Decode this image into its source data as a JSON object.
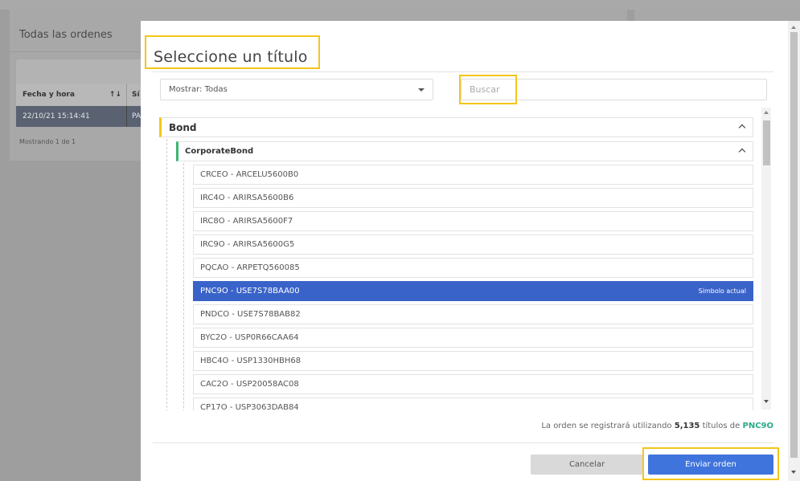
{
  "background": {
    "panel_title": "Todas las ordenes",
    "table": {
      "col1": "Fecha y hora",
      "col2": "Sí",
      "row_datetime": "22/10/21 15:14:41",
      "row_col2": "PA",
      "sort_glyph": "↑↓"
    },
    "footer": "Mostrando 1 de 1"
  },
  "modal": {
    "title": "Seleccione un título",
    "filter": {
      "selected": "Mostrar: Todas"
    },
    "search": {
      "placeholder": "Buscar",
      "value": ""
    },
    "tree": {
      "level1": "Bond",
      "level2": "CorporateBond",
      "items": [
        {
          "label": "CRCEO - ARCELU5600B0",
          "note": ""
        },
        {
          "label": "IRC4O - ARIRSA5600B6",
          "note": ""
        },
        {
          "label": "IRC8O - ARIRSA5600F7",
          "note": ""
        },
        {
          "label": "IRC9O - ARIRSA5600G5",
          "note": ""
        },
        {
          "label": "PQCAO - ARPETQ560085",
          "note": ""
        },
        {
          "label": "PNC9O - USE7S78BAA00",
          "note": "Símbolo actual"
        },
        {
          "label": "PNDCO - USE7S78BAB82",
          "note": ""
        },
        {
          "label": "BYC2O - USP0R66CAA64",
          "note": ""
        },
        {
          "label": "HBC4O - USP1330HBH68",
          "note": ""
        },
        {
          "label": "CAC2O - USP20058AC08",
          "note": ""
        },
        {
          "label": "CP17O - USP3063DAB84",
          "note": ""
        }
      ],
      "selected_index": 5
    },
    "summary": {
      "prefix": "La orden se registrará utilizando",
      "quantity": "5,135",
      "middle": "títulos de",
      "symbol": "PNC9O"
    },
    "buttons": {
      "cancel": "Cancelar",
      "submit": "Enviar orden"
    }
  },
  "colors": {
    "selected_row": "#3a63c9",
    "primary_button": "#3f74dc",
    "highlight_box": "#f5c518",
    "level1_accent": "#f5c518",
    "level2_accent": "#3cb371",
    "symbol_text": "#2aaa8a"
  }
}
